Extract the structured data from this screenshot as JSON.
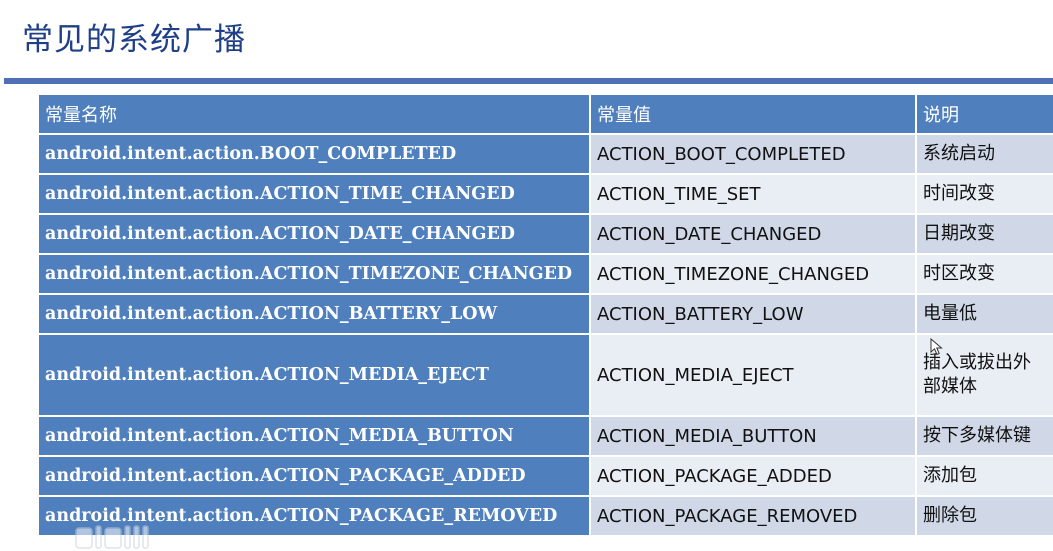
{
  "page": {
    "title": "常见的系统广播"
  },
  "table": {
    "headers": [
      "常量名称",
      "常量值",
      "说明"
    ],
    "rows": [
      {
        "name": "android.intent.action.BOOT_COMPLETED",
        "value": "ACTION_BOOT_COMPLETED",
        "desc": "系统启动"
      },
      {
        "name": "android.intent.action.ACTION_TIME_CHANGED",
        "value": "ACTION_TIME_SET",
        "desc": "时间改变"
      },
      {
        "name": "android.intent.action.ACTION_DATE_CHANGED",
        "value": "ACTION_DATE_CHANGED",
        "desc": "日期改变"
      },
      {
        "name": "android.intent.action.ACTION_TIMEZONE_CHANGED",
        "value": "ACTION_TIMEZONE_CHANGED",
        "desc": "时区改变"
      },
      {
        "name": "android.intent.action.ACTION_BATTERY_LOW",
        "value": "ACTION_BATTERY_LOW",
        "desc": "电量低"
      },
      {
        "name": "android.intent.action.ACTION_MEDIA_EJECT",
        "value": "ACTION_MEDIA_EJECT",
        "desc": "插入或拔出外部媒体"
      },
      {
        "name": "android.intent.action.ACTION_MEDIA_BUTTON",
        "value": "ACTION_MEDIA_BUTTON",
        "desc": "按下多媒体键"
      },
      {
        "name": "android.intent.action.ACTION_PACKAGE_ADDED",
        "value": "ACTION_PACKAGE_ADDED",
        "desc": "添加包"
      },
      {
        "name": "android.intent.action.ACTION_PACKAGE_REMOVED",
        "value": "ACTION_PACKAGE_REMOVED",
        "desc": "删除包"
      }
    ]
  },
  "colors": {
    "title": "#1f3f86",
    "header_bg": "#4f80bd",
    "row_dark": "#d0d8e8",
    "row_light": "#e9edf4",
    "rule": "#4f71b4"
  },
  "icons": {
    "cursor": "mouse-pointer-icon",
    "watermark": "bilibili-logo-icon"
  }
}
